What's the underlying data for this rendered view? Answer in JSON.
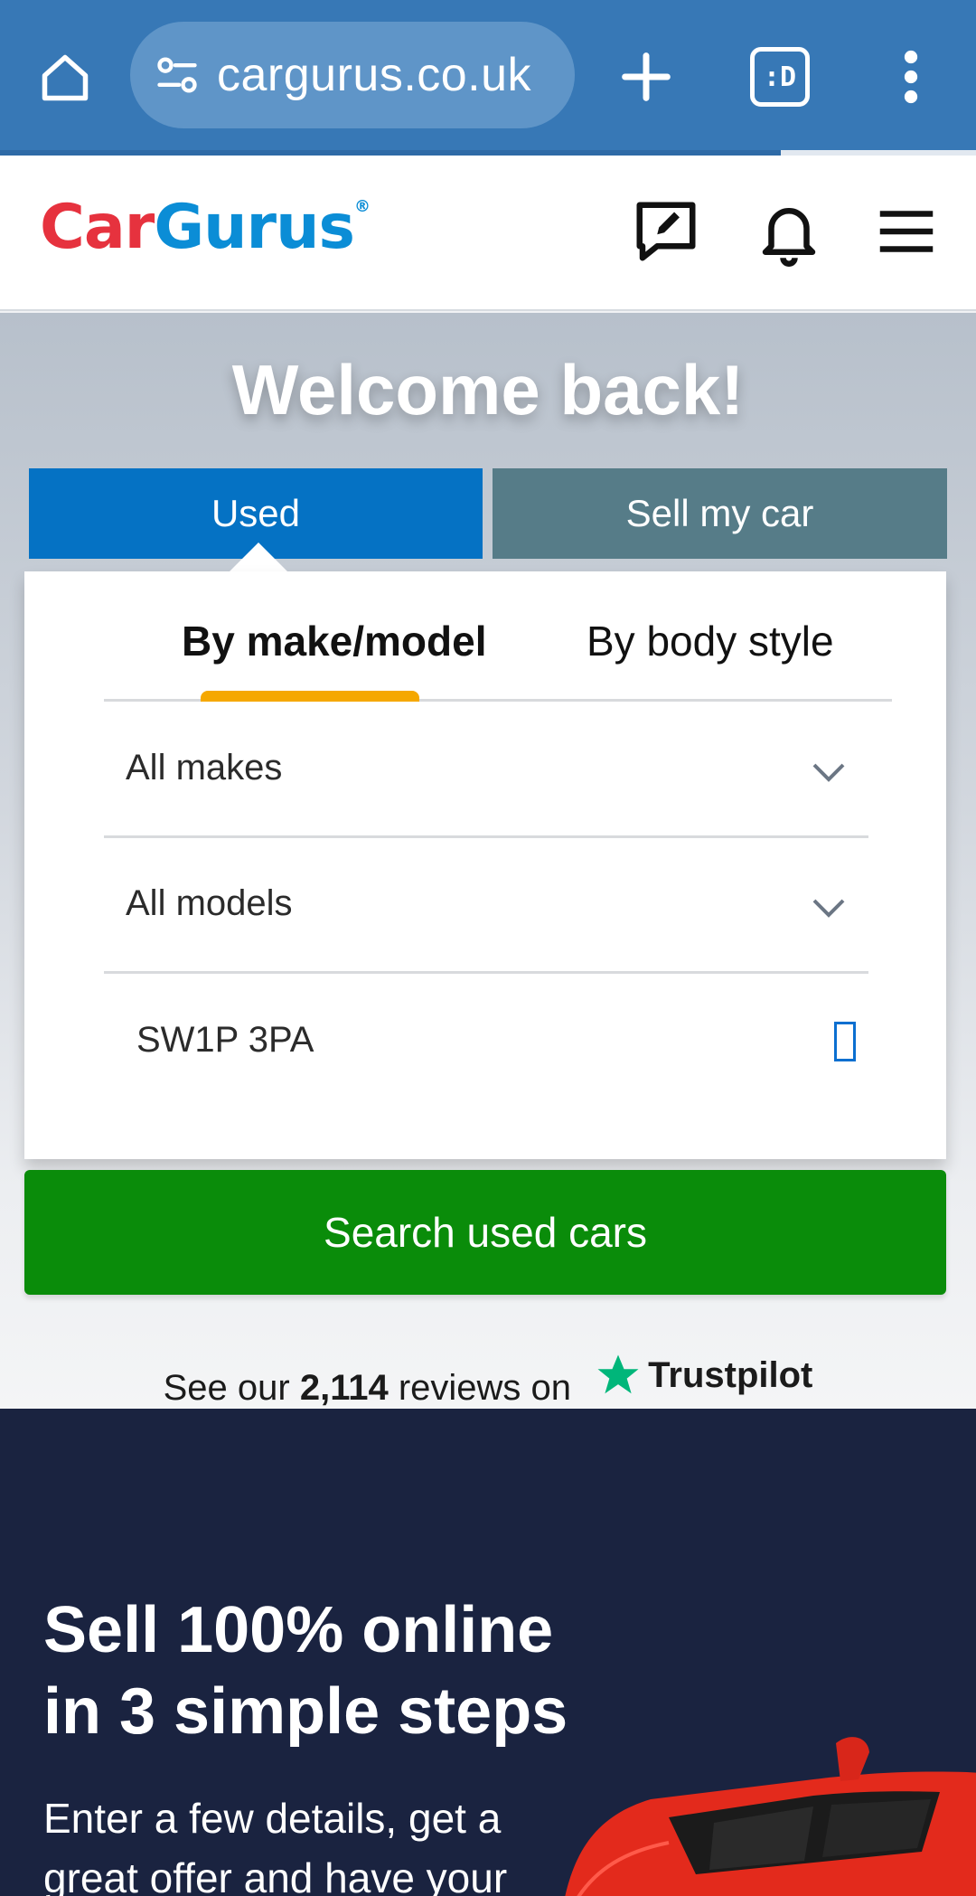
{
  "browser": {
    "url": "cargurus.co.uk",
    "tab_icon_text": ":D",
    "load_progress": 0.8
  },
  "header": {
    "logo": {
      "car": "Car",
      "gurus": "Gurus",
      "reg": "®"
    }
  },
  "hero": {
    "welcome": "Welcome back!",
    "tabs": {
      "used": "Used",
      "sell": "Sell my car"
    },
    "subtabs": {
      "make_model": "By make/model",
      "body_style": "By body style"
    },
    "makes": "All makes",
    "models": "All models",
    "postcode": "SW1P 3PA",
    "search_button": "Search used cars"
  },
  "trustpilot": {
    "prefix": "See our",
    "count": "2,114",
    "suffix": "reviews on",
    "brand": "Trustpilot"
  },
  "promo": {
    "title_line1": "Sell 100% online",
    "title_line2": "in 3 simple steps",
    "text_line1": "Enter a few details, get a",
    "text_line2": "great offer and have your"
  },
  "colors": {
    "chrome": "#3778b6",
    "used_tab": "#0572c4",
    "sell_tab": "#567c88",
    "search_button": "#0a8c0a",
    "active_underline": "#f5a800",
    "promo_bg": "#1a2340",
    "trustpilot_star": "#00b67a"
  }
}
